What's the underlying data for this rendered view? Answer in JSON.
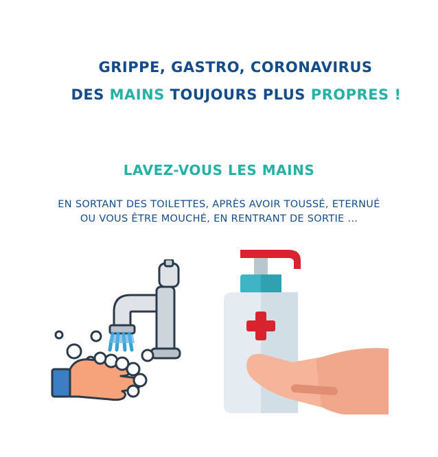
{
  "headline": {
    "line1": "GRIPPE, GASTRO, CORONAVIRUS",
    "line2_part1": "DES ",
    "line2_part2": "MAINS",
    "line2_part3": " TOUJOURS PLUS ",
    "line2_part4": "PROPRES",
    "line2_part5": " !"
  },
  "instruction": {
    "title": "LAVEZ-VOUS LES MAINS",
    "line1": "EN SORTANT DES TOILETTES, APRÈS AVOIR TOUSSÉ, ETERNUÉ",
    "line2": "OU VOUS ÊTRE MOUCHÉ, EN RENTRANT DE SORTIE ..."
  },
  "illustrations": {
    "left_icon": "handwashing-under-tap-icon",
    "right_icon": "hand-sanitizer-pump-icon"
  },
  "colors": {
    "navy": "#134b8b",
    "teal": "#27b0a6",
    "red": "#d9232f",
    "skin": "#f6b49b"
  }
}
